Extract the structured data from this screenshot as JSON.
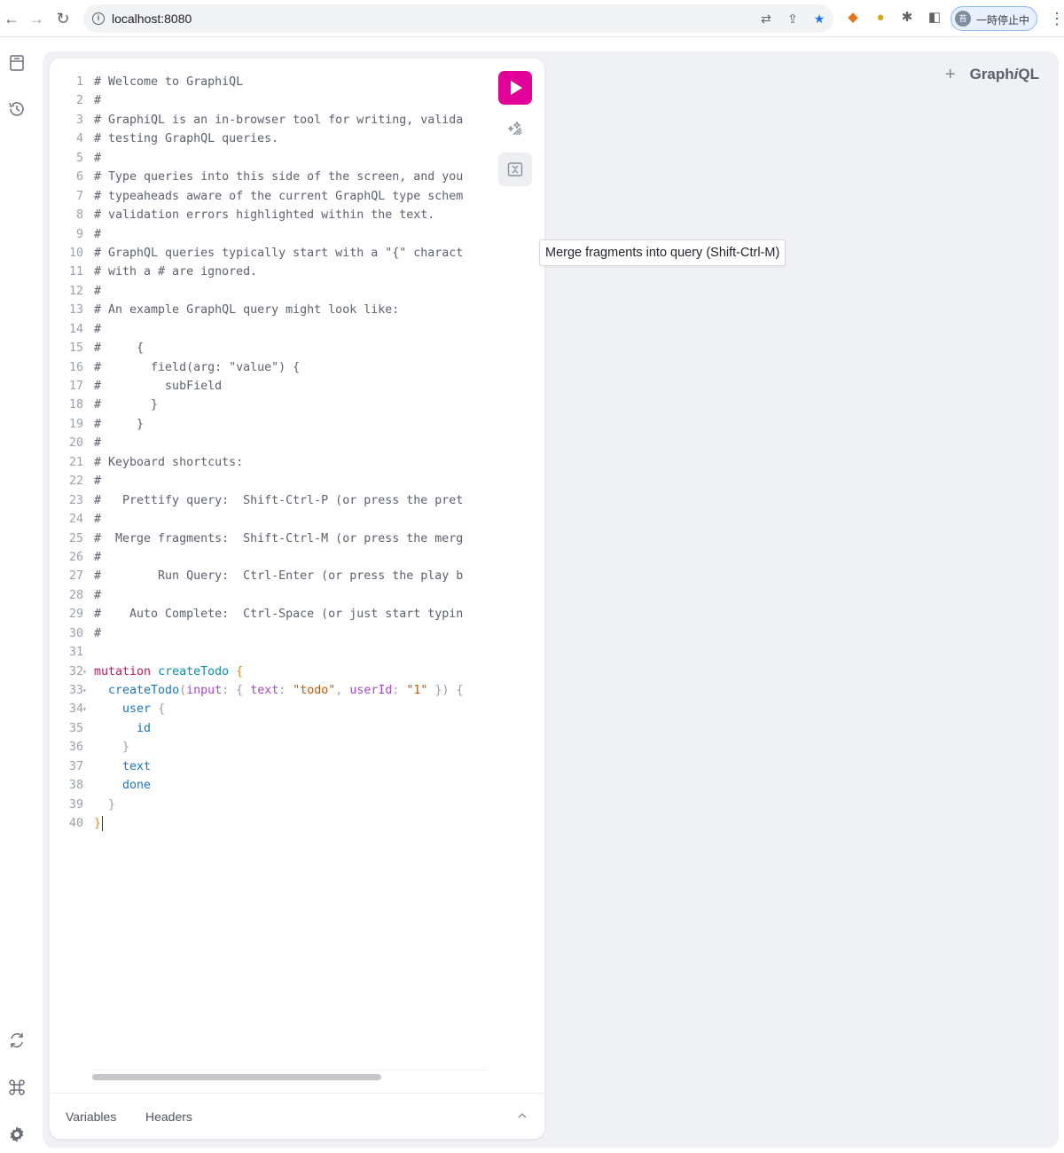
{
  "browser": {
    "url": "localhost:8080",
    "profile_label": "一時停止中",
    "profile_avatar": "苔"
  },
  "header": {
    "logo_prefix": "Graph",
    "logo_i": "i",
    "logo_suffix": "QL"
  },
  "toolbar": {
    "tooltip": "Merge fragments into query (Shift-Ctrl-M)"
  },
  "bottom_tabs": [
    {
      "label": "Variables"
    },
    {
      "label": "Headers"
    }
  ],
  "editor": {
    "lines": [
      "# Welcome to GraphiQL",
      "#",
      "# GraphiQL is an in-browser tool for writing, valida",
      "# testing GraphQL queries.",
      "#",
      "# Type queries into this side of the screen, and you",
      "# typeaheads aware of the current GraphQL type schem",
      "# validation errors highlighted within the text.",
      "#",
      "# GraphQL queries typically start with a \"{\" charact",
      "# with a # are ignored.",
      "#",
      "# An example GraphQL query might look like:",
      "#",
      "#     {",
      "#       field(arg: \"value\") {",
      "#         subField",
      "#       }",
      "#     }",
      "#",
      "# Keyboard shortcuts:",
      "#",
      "#   Prettify query:  Shift-Ctrl-P (or press the pret",
      "#",
      "#  Merge fragments:  Shift-Ctrl-M (or press the merg",
      "#",
      "#        Run Query:  Ctrl-Enter (or press the play b",
      "#",
      "#    Auto Complete:  Ctrl-Space (or just start typin",
      "#",
      ""
    ],
    "mutation": {
      "keyword": "mutation",
      "name": "createTodo",
      "open": "{",
      "field": "createTodo",
      "paren_open": "(",
      "arg": "input",
      "colon": ":",
      "obj_open": "{",
      "key1": "text",
      "val1": "\"todo\"",
      "comma": ",",
      "key2": "userId",
      "val2": "\"1\"",
      "obj_close": "})",
      "trail": "{",
      "user": "user",
      "user_open": "{",
      "id": "id",
      "user_close": "}",
      "text": "text",
      "done": "done",
      "inner_close": "}",
      "close": "}"
    }
  }
}
